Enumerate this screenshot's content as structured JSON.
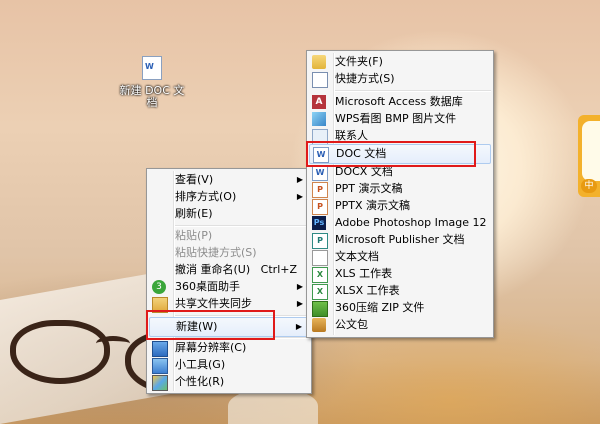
{
  "desktop": {
    "icon_label": "新建 DOC 文档"
  },
  "context_menu": {
    "items": [
      {
        "label": "查看(V)",
        "arrow": "▶"
      },
      {
        "label": "排序方式(O)",
        "arrow": "▶"
      },
      {
        "label": "刷新(E)"
      },
      {
        "label": "粘贴(P)"
      },
      {
        "label": "粘贴快捷方式(S)"
      },
      {
        "label": "撤消 重命名(U)",
        "shortcut": "Ctrl+Z"
      },
      {
        "label": "360桌面助手",
        "arrow": "▶"
      },
      {
        "label": "共享文件夹同步",
        "arrow": "▶"
      },
      {
        "label": "新建(W)",
        "arrow": "▶"
      },
      {
        "label": "屏幕分辨率(C)"
      },
      {
        "label": "小工具(G)"
      },
      {
        "label": "个性化(R)"
      }
    ]
  },
  "new_submenu": {
    "items": [
      {
        "label": "文件夹(F)",
        "icon": "folder-icon"
      },
      {
        "label": "快捷方式(S)",
        "icon": "shortcut-icon"
      },
      {
        "label": "Microsoft Access 数据库",
        "icon": "access-icon"
      },
      {
        "label": "WPS看图 BMP 图片文件",
        "icon": "bmp-image-icon"
      },
      {
        "label": "联系人",
        "icon": "contact-icon"
      },
      {
        "label": "DOC 文档",
        "icon": "doc-icon"
      },
      {
        "label": "DOCX 文档",
        "icon": "docx-icon"
      },
      {
        "label": "PPT 演示文稿",
        "icon": "ppt-icon"
      },
      {
        "label": "PPTX 演示文稿",
        "icon": "pptx-icon"
      },
      {
        "label": "Adobe Photoshop Image 12",
        "icon": "photoshop-icon"
      },
      {
        "label": "Microsoft Publisher 文档",
        "icon": "publisher-icon"
      },
      {
        "label": "文本文档",
        "icon": "text-doc-icon"
      },
      {
        "label": "XLS 工作表",
        "icon": "xls-icon"
      },
      {
        "label": "XLSX 工作表",
        "icon": "xlsx-icon"
      },
      {
        "label": "360压缩 ZIP 文件",
        "icon": "zip-icon"
      },
      {
        "label": "公文包",
        "icon": "briefcase-icon"
      }
    ]
  },
  "side_widget": {
    "button_label": "中"
  },
  "colors": {
    "highlight_box": "#e01a1a",
    "menu_background": "#f5f5f5"
  }
}
